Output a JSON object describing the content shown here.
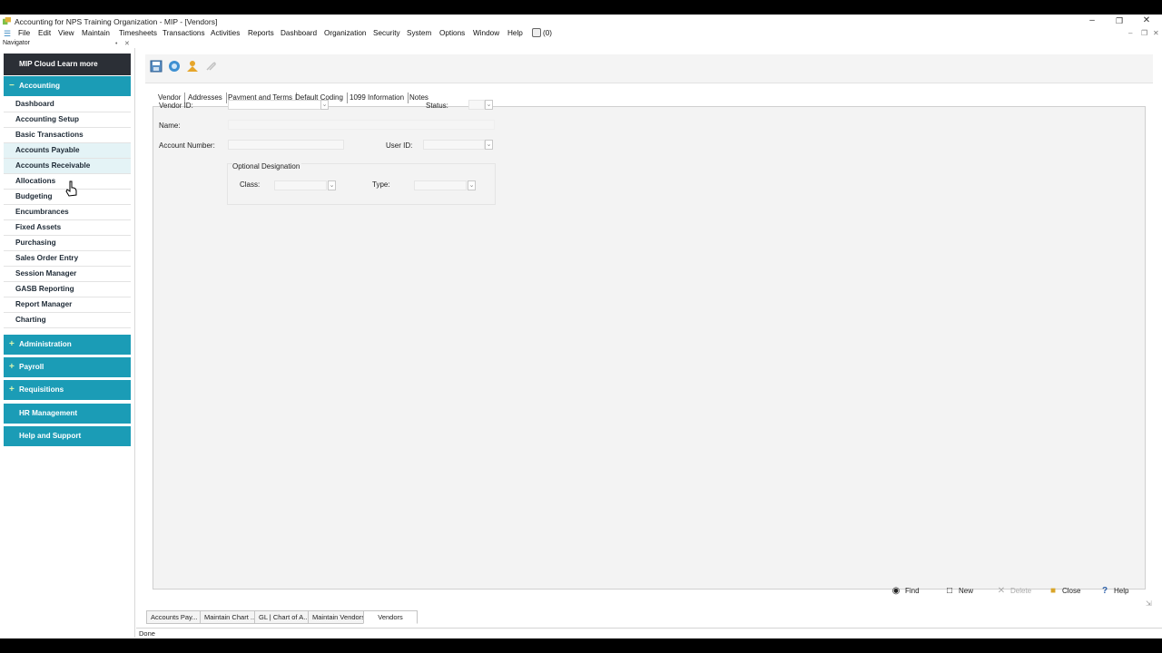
{
  "window": {
    "title": "Accounting for NPS Training Organization - MIP - [Vendors]"
  },
  "menubar": {
    "items": [
      "File",
      "Edit",
      "View",
      "Maintain",
      "Timesheets",
      "Transactions",
      "Activities",
      "Reports",
      "Dashboard",
      "Organization",
      "Security",
      "System",
      "Options",
      "Window",
      "Help"
    ],
    "notification_count": "(0)"
  },
  "navigator": {
    "label": "Navigator",
    "promo": "MIP Cloud Learn more",
    "accounting": {
      "label": "Accounting",
      "symbol": "−",
      "items": [
        "Dashboard",
        "Accounting Setup",
        "Basic Transactions",
        "Accounts Payable",
        "Accounts Receivable",
        "Allocations",
        "Budgeting",
        "Encumbrances",
        "Fixed Assets",
        "Purchasing",
        "Sales Order Entry",
        "Session Manager",
        "GASB Reporting",
        "Report Manager",
        "Charting"
      ]
    },
    "sections": [
      {
        "label": "Administration",
        "symbol": "+"
      },
      {
        "label": "Payroll",
        "symbol": "+"
      },
      {
        "label": "Requisitions",
        "symbol": "+"
      },
      {
        "label": "HR Management",
        "symbol": ""
      },
      {
        "label": "Help and Support",
        "symbol": ""
      }
    ]
  },
  "tabs": [
    "Vendor",
    "Addresses",
    "Payment and Terms",
    "Default Coding",
    "1099 Information",
    "Notes"
  ],
  "form": {
    "vendor_id_label": "Vendor ID:",
    "status_label": "Status:",
    "name_label": "Name:",
    "account_number_label": "Account Number:",
    "user_id_label": "User ID:",
    "optional_designation_label": "Optional Designation",
    "class_label": "Class:",
    "type_label": "Type:"
  },
  "buttons": {
    "find": "Find",
    "new": "New",
    "delete": "Delete",
    "close": "Close",
    "help": "Help"
  },
  "window_tabs": [
    "Accounts Pay...",
    "Maintain Chart ...",
    "GL | Chart of A...",
    "Maintain Vendors",
    "Vendors"
  ],
  "status": "Done",
  "colors": {
    "nav_accent": "#1b9cb6",
    "nav_dark": "#2b2f36"
  }
}
